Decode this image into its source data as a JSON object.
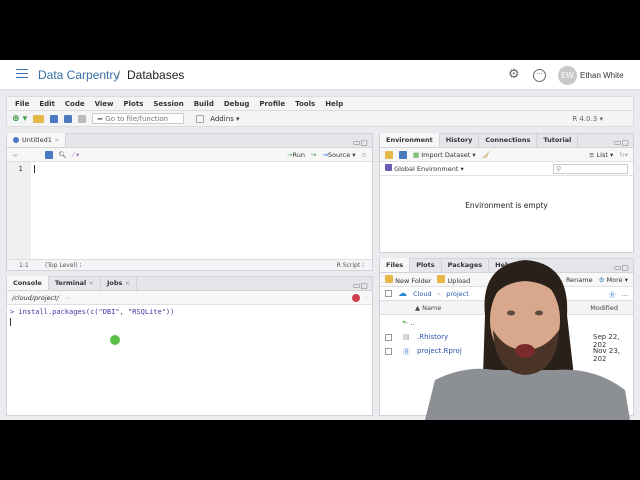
{
  "header": {
    "project_space": "Data Carpentry",
    "separator": "/",
    "project": "Databases",
    "user_initials": "EW",
    "user_name": "Ethan White"
  },
  "menu": [
    "File",
    "Edit",
    "Code",
    "View",
    "Plots",
    "Session",
    "Build",
    "Debug",
    "Profile",
    "Tools",
    "Help"
  ],
  "toolbar": {
    "goto_placeholder": "Go to file/function",
    "addins": "Addins",
    "r_version": "R 4.0.3"
  },
  "source": {
    "tab": "Untitled1",
    "run": "Run",
    "source": "Source",
    "line_number": "1",
    "position": "1:1",
    "scope": "(Top Level)",
    "file_type": "R Script"
  },
  "console": {
    "tabs": [
      "Console",
      "Terminal",
      "Jobs"
    ],
    "path": "/cloud/project/",
    "command": "> install.packages(c(\"DBI\", \"RSQLite\"))"
  },
  "environment": {
    "tabs": [
      "Environment",
      "History",
      "Connections",
      "Tutorial"
    ],
    "import_dataset": "Import Dataset",
    "list": "List",
    "scope": "Global Environment",
    "empty_message": "Environment is empty"
  },
  "files": {
    "tabs": [
      "Files",
      "Plots",
      "Packages",
      "Help"
    ],
    "new_folder": "New Folder",
    "upload": "Upload",
    "rename": "Rename",
    "more": "More",
    "path": [
      "Cloud",
      "project"
    ],
    "columns": {
      "name": "Name",
      "modified": "Modified"
    },
    "parent": "..",
    "rows": [
      {
        "name": ".Rhistory",
        "modified": "Sep 22, 202"
      },
      {
        "name": "project.Rproj",
        "modified": "Nov 23, 202"
      }
    ]
  },
  "colors": {
    "accent": "#3a6fa8",
    "link": "#2a55b0"
  }
}
